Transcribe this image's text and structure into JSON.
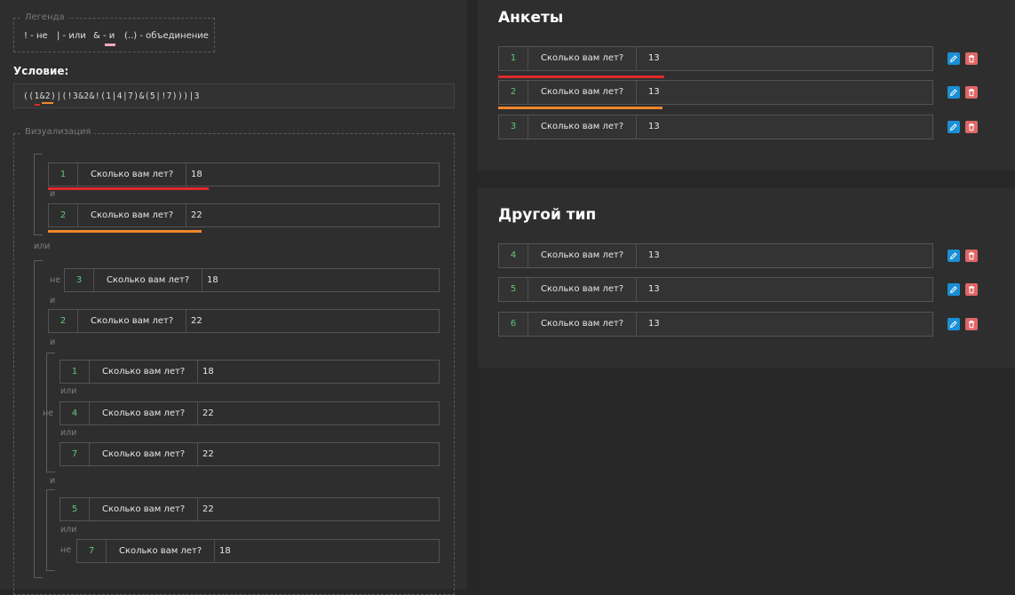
{
  "legend": {
    "title": "Легенда",
    "items": [
      "! - не",
      "| - или",
      "& - и",
      "(..) - объединение"
    ]
  },
  "condition": {
    "label": "Условие:",
    "value": "((1&2)|(!3&2&!(1|4|7)&(5|!7)))|3"
  },
  "visualization": {
    "title": "Визуализация",
    "rows": [
      {
        "num": "1",
        "question": "Сколько вам лет?",
        "value": "18"
      },
      {
        "num": "2",
        "question": "Сколько вам лет?",
        "value": "22"
      },
      {
        "num": "3",
        "question": "Сколько вам лет?",
        "value": "18"
      },
      {
        "num": "2",
        "question": "Сколько вам лет?",
        "value": "22"
      },
      {
        "num": "1",
        "question": "Сколько вам лет?",
        "value": "18"
      },
      {
        "num": "4",
        "question": "Сколько вам лет?",
        "value": "22"
      },
      {
        "num": "7",
        "question": "Сколько вам лет?",
        "value": "22"
      },
      {
        "num": "5",
        "question": "Сколько вам лет?",
        "value": "22"
      },
      {
        "num": "7",
        "question": "Сколько вам лет?",
        "value": "18"
      }
    ],
    "ops": {
      "and": "и",
      "or": "или",
      "not": "не"
    }
  },
  "cards": [
    {
      "title": "Анкеты",
      "rows": [
        {
          "num": "1",
          "question": "Сколько вам лет?",
          "value": "13"
        },
        {
          "num": "2",
          "question": "Сколько вам лет?",
          "value": "13"
        },
        {
          "num": "3",
          "question": "Сколько вам лет?",
          "value": "13"
        }
      ]
    },
    {
      "title": "Другой тип",
      "rows": [
        {
          "num": "4",
          "question": "Сколько вам лет?",
          "value": "13"
        },
        {
          "num": "5",
          "question": "Сколько вам лет?",
          "value": "13"
        },
        {
          "num": "6",
          "question": "Сколько вам лет?",
          "value": "13"
        }
      ]
    }
  ],
  "icons": {
    "edit": "pencil-icon",
    "delete": "trash-icon"
  },
  "colors": {
    "red": "#e02a2a",
    "orange": "#f0872a",
    "pink": "#f3a6c8",
    "green": "#5fca74",
    "edit": "#1b8fd6",
    "delete": "#e06767"
  }
}
